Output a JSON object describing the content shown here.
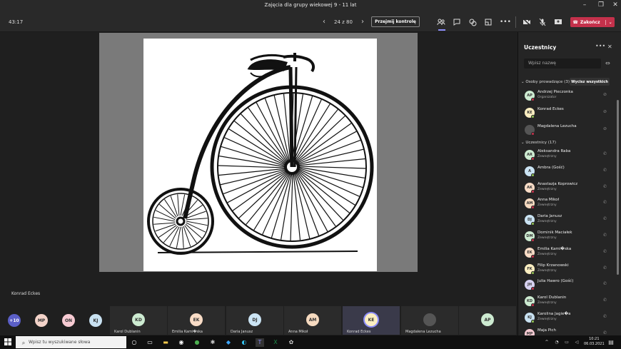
{
  "window": {
    "title": "Zajęcia dla grupy wiekowej 9 - 11 lat"
  },
  "toolbar": {
    "timer": "43:17",
    "pager": "24 z 80",
    "take_control": "Przejmij kontrolę",
    "leave": "Zakończ"
  },
  "stage": {
    "presenter": "Konrad Eckes"
  },
  "strip": {
    "overflow": "+10",
    "small": [
      {
        "initials": "MP",
        "color": "#f3d3c9"
      },
      {
        "initials": "ON",
        "color": "#f7cbd3"
      },
      {
        "initials": "KJ",
        "color": "#c8e1f1"
      }
    ],
    "tiles": [
      {
        "initials": "KD",
        "name": "Karol Dublanin",
        "color": "#cdebd1"
      },
      {
        "initials": "EK",
        "name": "Emilia Kami�ska",
        "color": "#f9dcc6"
      },
      {
        "initials": "DJ",
        "name": "Daria Janusz",
        "color": "#cbe4f4"
      },
      {
        "initials": "AM",
        "name": "Anna Mikoł",
        "color": "#f6dac0"
      },
      {
        "initials": "KE",
        "name": "Konrad Eckes",
        "color": "#fbeec1"
      },
      {
        "initials": "",
        "name": "Magdalena Lezucha",
        "color": "#555555"
      },
      {
        "initials": "AP",
        "name": "",
        "color": "#cdebd1"
      }
    ]
  },
  "panel": {
    "title": "Uczestnicy",
    "search_placeholder": "Wpisz nazwę",
    "organizers_label": "Osoby prowadzące (3)",
    "show_all": "Wycisz wszystkich",
    "participants_label": "Uczestnicy (17)",
    "organizers": [
      {
        "initials": "AP",
        "name": "Andrzej Pieczonka",
        "sub": "Organizator",
        "color": "#cdebd1"
      },
      {
        "initials": "KE",
        "name": "Konrad Eckes",
        "sub": "",
        "color": "#fbeec1"
      },
      {
        "initials": "",
        "name": "Magdalena Lezucha",
        "sub": "",
        "color": "#555555"
      }
    ],
    "participants": [
      {
        "initials": "AR",
        "name": "Aleksandra Raba",
        "sub": "Zewnętrzny",
        "color": "#cdebd1"
      },
      {
        "initials": "A",
        "name": "Ambra (Gość)",
        "sub": "",
        "color": "#cbe4f4"
      },
      {
        "initials": "AK",
        "name": "Anastazja Koprowicz",
        "sub": "Zewnętrzny",
        "color": "#f9dcc6"
      },
      {
        "initials": "AM",
        "name": "Anna Mikoł",
        "sub": "Zewnętrzny",
        "color": "#f6dac0"
      },
      {
        "initials": "DJ",
        "name": "Daria Janusz",
        "sub": "Zewnętrzny",
        "color": "#cbe4f4"
      },
      {
        "initials": "DM",
        "name": "Dominik Maciałek",
        "sub": "Zewnętrzny",
        "color": "#cdebd1"
      },
      {
        "initials": "EK",
        "name": "Emilia Kami�ska",
        "sub": "Zewnętrzny",
        "color": "#f9dcc6"
      },
      {
        "initials": "FK",
        "name": "Filip Krzanowski",
        "sub": "Zewnętrzny",
        "color": "#fbeec1"
      },
      {
        "initials": "JH",
        "name": "Julia Hawro (Gość)",
        "sub": "",
        "color": "#d6d1f0"
      },
      {
        "initials": "KD",
        "name": "Karol Dublanin",
        "sub": "Zewnętrzny",
        "color": "#cdebd1"
      },
      {
        "initials": "KJ",
        "name": "Karolina Jagie�a",
        "sub": "Zewnętrzny",
        "color": "#c8e1f1"
      },
      {
        "initials": "MP",
        "name": "Maja Pich",
        "sub": "",
        "color": "#f7cbd3"
      }
    ]
  },
  "taskbar": {
    "search_placeholder": "Wpisz tu wyszukiwane słowa",
    "time": "10:21",
    "date": "06.03.2021"
  }
}
